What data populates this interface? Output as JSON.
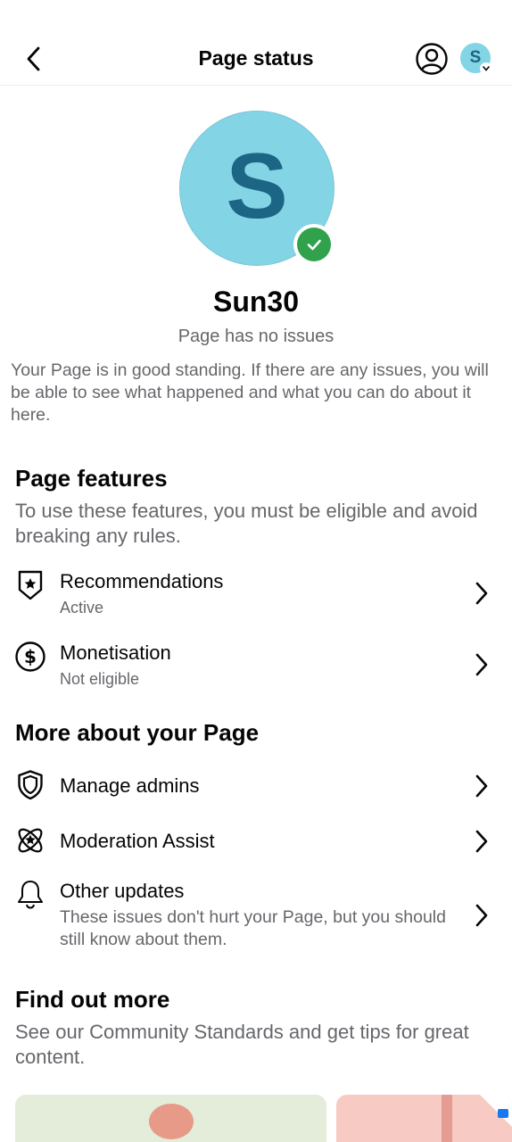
{
  "header": {
    "title": "Page status",
    "back_icon": "chevron-left-icon",
    "profile_icon": "person-circle-icon",
    "avatar_letter": "S"
  },
  "profile": {
    "avatar_letter": "S",
    "avatar_color": "#83d4e4",
    "avatar_letter_color": "#1c6585",
    "badge_color": "#31a24c",
    "name": "Sun30",
    "status": "Page has no issues",
    "description": "Your Page is in good standing. If there are any issues, you will be able to see what happened and what you can do about it here."
  },
  "page_features": {
    "title": "Page features",
    "description": "To use these features, you must be eligible and avoid breaking any rules.",
    "items": [
      {
        "label": "Recommendations",
        "sub": "Active",
        "icon": "shield-star-icon"
      },
      {
        "label": "Monetisation",
        "sub": "Not eligible",
        "icon": "dollar-circle-icon"
      }
    ]
  },
  "more_about": {
    "title": "More about your Page",
    "items": [
      {
        "label": "Manage admins",
        "icon": "shield-icon"
      },
      {
        "label": "Moderation Assist",
        "icon": "atom-star-icon"
      },
      {
        "label": "Other updates",
        "sub": "These issues don't hurt your Page, but you should still know about them.",
        "icon": "bell-icon"
      }
    ]
  },
  "find_out_more": {
    "title": "Find out more",
    "description": "See our Community Standards and get tips for great content."
  },
  "colors": {
    "text_primary": "#050505",
    "text_secondary": "#65676b",
    "accent_blue": "#1877f2"
  }
}
